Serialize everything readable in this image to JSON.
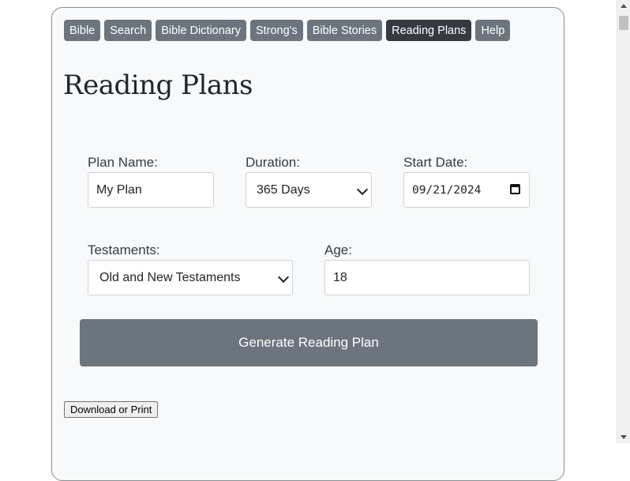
{
  "nav": {
    "items": [
      {
        "label": "Bible"
      },
      {
        "label": "Search"
      },
      {
        "label": "Bible Dictionary"
      },
      {
        "label": "Strong's"
      },
      {
        "label": "Bible Stories"
      },
      {
        "label": "Reading Plans",
        "active": true
      },
      {
        "label": "Help"
      }
    ]
  },
  "page": {
    "title": "Reading Plans"
  },
  "form": {
    "plan_name": {
      "label": "Plan Name:",
      "value": "My Plan"
    },
    "duration": {
      "label": "Duration:",
      "value": "365 Days"
    },
    "start_date": {
      "label": "Start Date:",
      "value": "09/21/2024"
    },
    "testaments": {
      "label": "Testaments:",
      "value": "Old and New Testaments"
    },
    "age": {
      "label": "Age:",
      "value": "18"
    },
    "generate_label": "Generate Reading Plan"
  },
  "download_label": "Download or Print",
  "colors": {
    "button": "#6c757d",
    "button_active": "#343a40",
    "card_bg": "#f8f9fa"
  }
}
